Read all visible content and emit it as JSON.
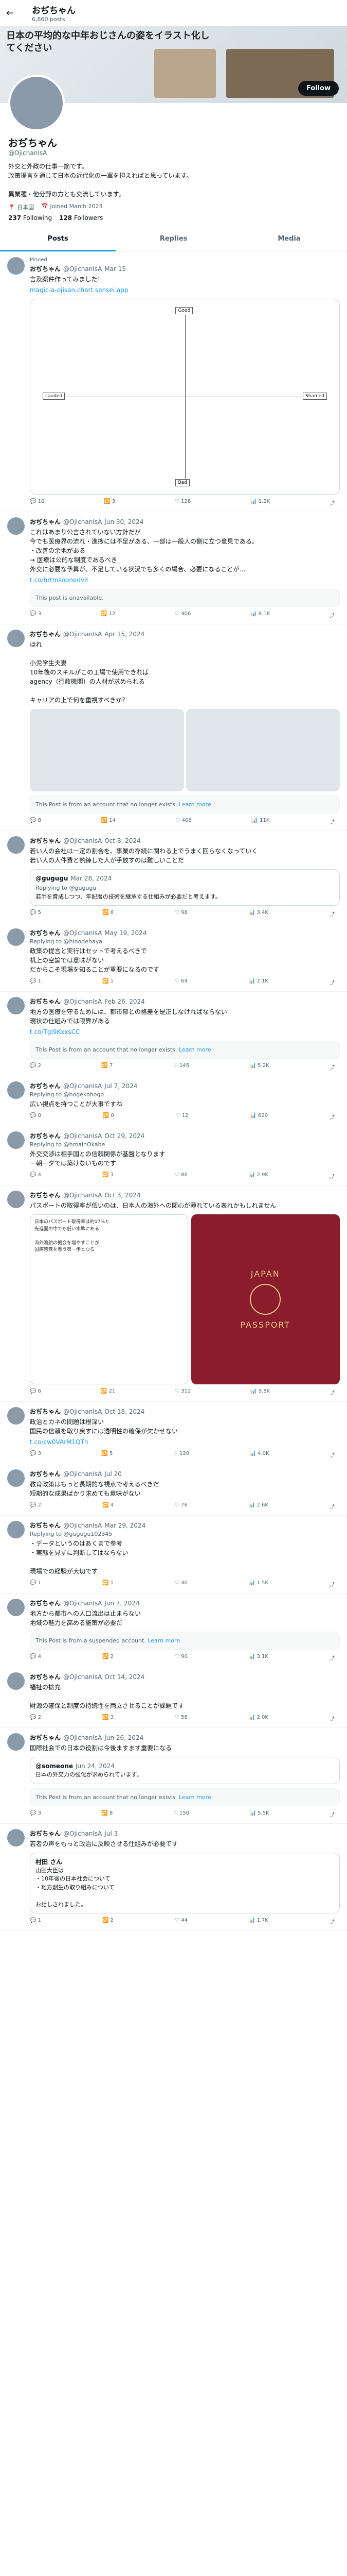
{
  "topbar": {
    "name": "おぢちゃん",
    "sub": "6,860 posts"
  },
  "banner": {
    "title": "日本の平均的な中年おじさんの姿をイラスト化してください"
  },
  "profile": {
    "follow_label": "Follow",
    "name": "おぢちゃん",
    "handle": "@OjichanIsA",
    "bio": "外交と外政の仕事一筋です。\n政策提言を通じて日本の近代化の一翼を担えればと思っています。\n\n異業種・他分野の方とも交流しています。",
    "location": "日本国",
    "joined": "Joined March 2023",
    "following_count": "237",
    "following_label": "Following",
    "followers_count": "128",
    "followers_label": "Followers"
  },
  "tabs": [
    {
      "label": "Posts"
    },
    {
      "label": "Replies"
    },
    {
      "label": "Media"
    }
  ],
  "tweets": [
    {
      "pinned": "Pinned",
      "name": "おぢちゃん",
      "handle": "@OjichanIsA",
      "date": "Mar 15",
      "text": "言及案件作ってみました！",
      "link": "magic-a-ojisan.chart.sensei.app",
      "chart_labels": {
        "top": "Good",
        "bottom": "Bad",
        "left": "Lauded",
        "right": "Shamed"
      },
      "acts": {
        "reply": "10",
        "rt": "3",
        "like": "128",
        "views": "1.2K"
      }
    },
    {
      "name": "おぢちゃん",
      "handle": "@OjichanIsA",
      "date": "Jun 30, 2024",
      "text": "これはあまり公言されていない方針だが\n今でも医療界の流れ・進捗には不足がある、一部は一般人の側に立つ意見である。\n・改善の余地がある\n→ 医療は公的な制度であるべき\n外交に必要な予算が、不足している状況でも多くの場合、必要になることが…",
      "link": "t.co/hrtmsoonedvit",
      "acts": {
        "reply": "3",
        "rt": "12",
        "like": "406",
        "views": "8.1K"
      },
      "notice": "This post is unavailable."
    },
    {
      "name": "おぢちゃん",
      "handle": "@OjichanIsA",
      "date": "Apr 15, 2024",
      "text": "ほれ\n\n小児学生夫妻\n10年後のスキルがこの工場で使用できれば\nagency（行政機関）の人材が求められる\n\nキャリアの上で何を重視すべきか？",
      "acts": {
        "reply": "8",
        "rt": "14",
        "like": "406",
        "views": "11K"
      },
      "notice": "This Post is from an account that no longer exists.",
      "notice_link": "Learn more"
    },
    {
      "name": "おぢちゃん",
      "handle": "@OjichanIsA",
      "date": "Oct 8, 2024",
      "text": "若い人の会社は一定の割合を、事業の存続に関わる上でうまく回らなくなっていく\n若い人の人件費と熟練した人が手放すのは難しいことだ",
      "quote_name": "@gugugu",
      "quote_date": "Mar 28, 2024",
      "quote_replying": "Replying to @gugugu",
      "quote_text": "若手を育成しつつ、年配層の技術を継承する仕組みが必要だと考えます。",
      "acts": {
        "reply": "5",
        "rt": "6",
        "like": "98",
        "views": "3.4K"
      }
    },
    {
      "name": "おぢちゃん",
      "handle": "@OjichanIsA",
      "date": "May 19, 2024",
      "replying": "Replying to @hinodehaya",
      "text": "政策の提言と実行はセットで考えるべきで\n机上の空論では意味がない\nだからこそ現場を知ることが重要になるのです",
      "acts": {
        "reply": "1",
        "rt": "1",
        "like": "64",
        "views": "2.1K"
      }
    },
    {
      "name": "おぢちゃん",
      "handle": "@OjichanIsA",
      "date": "Feb 26, 2024",
      "text": "地方の医療を守るためには、都市部との格差を是正しなければならない\n現状の仕組みでは限界がある",
      "link": "t.co/Tgl9KxxsCC",
      "acts": {
        "reply": "2",
        "rt": "7",
        "like": "145",
        "views": "5.2K"
      },
      "notice": "This Post is from an account that no longer exists.",
      "notice_link": "Learn more"
    },
    {
      "name": "おぢちゃん",
      "handle": "@OjichanIsA",
      "date": "Jul 7, 2024",
      "replying": "Replying to @hogekohogo",
      "text": "広い視点を持つことが大事ですね",
      "acts": {
        "reply": "0",
        "rt": "0",
        "like": "12",
        "views": "620"
      }
    },
    {
      "name": "おぢちゃん",
      "handle": "@OjichanIsA",
      "date": "Oct 29, 2024",
      "replying": "Replying to @hmainOkabe",
      "text": "外交交渉は相手国との信頼関係が基盤となります\n一朝一夕では築けないものです",
      "acts": {
        "reply": "4",
        "rt": "3",
        "like": "88",
        "views": "2.9K"
      }
    },
    {
      "name": "おぢちゃん",
      "handle": "@OjichanIsA",
      "date": "Oct 3, 2024",
      "text": "パスポートの取得率が低いのは、日本人の海外への関心が薄れている表れかもしれません",
      "passport_caption": "日本のパスポート取得率は約17%と\n先進国の中でも低い水準にある\n\n海外渡航の機会を増やすことが\n国際感覚を養う第一歩となる",
      "passport_title": "JAPAN",
      "passport_sub": "PASSPORT",
      "acts": {
        "reply": "6",
        "rt": "21",
        "like": "312",
        "views": "9.8K"
      }
    },
    {
      "name": "おぢちゃん",
      "handle": "@OjichanIsA",
      "date": "Oct 18, 2024",
      "text": "政治とカネの問題は根深い\n国民の信頼を取り戻すには透明性の確保が欠かせない",
      "link": "t.co/cw0VArM1QTh",
      "acts": {
        "reply": "3",
        "rt": "5",
        "like": "120",
        "views": "4.0K"
      }
    },
    {
      "name": "おぢちゃん",
      "handle": "@OjichanIsA",
      "date": "Jul 20",
      "text": "教育政策はもっと長期的な視点で考えるべきだ\n短期的な成果ばかり求めても意味がない",
      "acts": {
        "reply": "2",
        "rt": "4",
        "like": "76",
        "views": "2.6K"
      }
    },
    {
      "name": "おぢちゃん",
      "handle": "@OjichanIsA",
      "date": "Mar 29, 2024",
      "replying": "Replying to @gugugu102345",
      "text": "・データというのはあくまで参考\n・実態を見ずに判断してはならない\n\n現場での経験が大切です",
      "acts": {
        "reply": "1",
        "rt": "1",
        "like": "40",
        "views": "1.5K"
      }
    },
    {
      "name": "おぢちゃん",
      "handle": "@OjichanIsA",
      "date": "Jun 7, 2024",
      "text": "地方から都市への人口流出は止まらない\n地域の魅力を高める施策が必要だ",
      "acts": {
        "reply": "4",
        "rt": "2",
        "like": "90",
        "views": "3.1K"
      },
      "notice": "This Post is from a suspended account.",
      "notice_link": "Learn more"
    },
    {
      "name": "おぢちゃん",
      "handle": "@OjichanIsA",
      "date": "Oct 14, 2024",
      "text": "福祉の拡充\n\n財源の確保と制度の持続性を両立させることが課題です",
      "acts": {
        "reply": "2",
        "rt": "3",
        "like": "58",
        "views": "2.0K"
      }
    },
    {
      "name": "おぢちゃん",
      "handle": "@OjichanIsA",
      "date": "Jun 26, 2024",
      "text": "国際社会での日本の役割は今後ますます重要になる",
      "quote_name": "@someone",
      "quote_date": "Jun 24, 2024",
      "quote_replying": "",
      "quote_text": "日本の外交力の強化が求められています。",
      "acts": {
        "reply": "3",
        "rt": "8",
        "like": "150",
        "views": "5.5K"
      },
      "notice": "This Post is from an account that no longer exists.",
      "notice_link": "Learn more"
    },
    {
      "name": "おぢちゃん",
      "handle": "@OjichanIsA",
      "date": "Jul 3",
      "text": "若者の声をもっと政治に反映させる仕組みが必要です",
      "quote_name": "村田 さん",
      "quote_date": "",
      "quote_replying": "",
      "quote_text": "山田大臣は\n・10年後の日本社会について\n・地方創生の取り組みについて\n\nお話しされました。",
      "acts": {
        "reply": "1",
        "rt": "2",
        "like": "44",
        "views": "1.7K"
      }
    }
  ]
}
